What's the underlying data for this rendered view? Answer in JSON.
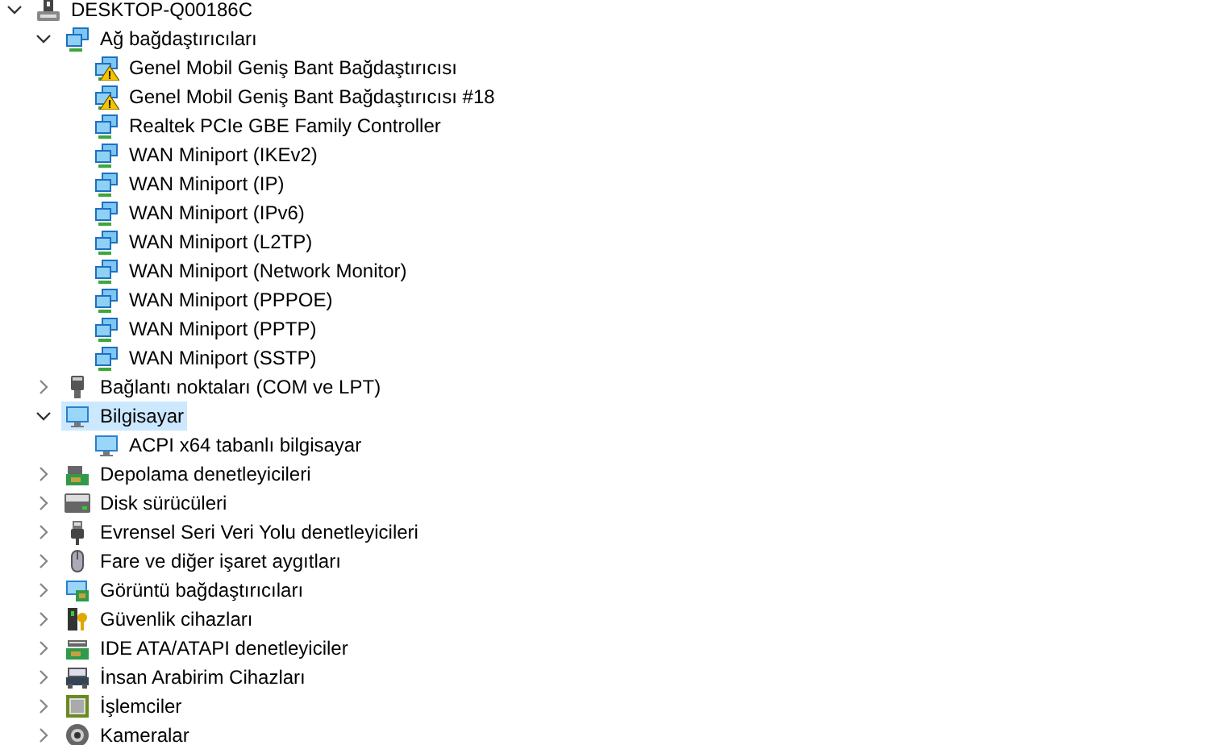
{
  "tree": [
    {
      "label": "DESKTOP-Q00186C",
      "kind": "computer",
      "expanded": true,
      "selected": false,
      "children": [
        {
          "label": "Ağ bağdaştırıcıları",
          "kind": "network",
          "expanded": true,
          "selected": false,
          "children": [
            {
              "label": "Genel Mobil Geniş Bant Bağdaştırıcısı",
              "kind": "network",
              "warning": true,
              "selected": false
            },
            {
              "label": "Genel Mobil Geniş Bant Bağdaştırıcısı #18",
              "kind": "network",
              "warning": true,
              "selected": false
            },
            {
              "label": "Realtek PCIe GBE Family Controller",
              "kind": "network",
              "warning": false,
              "selected": false
            },
            {
              "label": "WAN Miniport (IKEv2)",
              "kind": "network",
              "warning": false,
              "selected": false
            },
            {
              "label": "WAN Miniport (IP)",
              "kind": "network",
              "warning": false,
              "selected": false
            },
            {
              "label": "WAN Miniport (IPv6)",
              "kind": "network",
              "warning": false,
              "selected": false
            },
            {
              "label": "WAN Miniport (L2TP)",
              "kind": "network",
              "warning": false,
              "selected": false
            },
            {
              "label": "WAN Miniport (Network Monitor)",
              "kind": "network",
              "warning": false,
              "selected": false
            },
            {
              "label": "WAN Miniport (PPPOE)",
              "kind": "network",
              "warning": false,
              "selected": false
            },
            {
              "label": "WAN Miniport (PPTP)",
              "kind": "network",
              "warning": false,
              "selected": false
            },
            {
              "label": "WAN Miniport (SSTP)",
              "kind": "network",
              "warning": false,
              "selected": false
            }
          ]
        },
        {
          "label": "Bağlantı noktaları (COM ve LPT)",
          "kind": "port",
          "expanded": false,
          "selected": false
        },
        {
          "label": "Bilgisayar",
          "kind": "monitor",
          "expanded": true,
          "selected": true,
          "children": [
            {
              "label": "ACPI x64 tabanlı bilgisayar",
              "kind": "monitor",
              "warning": false,
              "selected": false
            }
          ]
        },
        {
          "label": "Depolama denetleyicileri",
          "kind": "storage",
          "expanded": false,
          "selected": false
        },
        {
          "label": "Disk sürücüleri",
          "kind": "disk",
          "expanded": false,
          "selected": false
        },
        {
          "label": "Evrensel Seri Veri Yolu denetleyicileri",
          "kind": "usb",
          "expanded": false,
          "selected": false
        },
        {
          "label": "Fare ve diğer işaret aygıtları",
          "kind": "mouse",
          "expanded": false,
          "selected": false
        },
        {
          "label": "Görüntü bağdaştırıcıları",
          "kind": "display",
          "expanded": false,
          "selected": false
        },
        {
          "label": "Güvenlik cihazları",
          "kind": "security",
          "expanded": false,
          "selected": false
        },
        {
          "label": "IDE ATA/ATAPI denetleyiciler",
          "kind": "ide",
          "expanded": false,
          "selected": false
        },
        {
          "label": "İnsan Arabirim Cihazları",
          "kind": "hid",
          "expanded": false,
          "selected": false
        },
        {
          "label": "İşlemciler",
          "kind": "cpu",
          "expanded": false,
          "selected": false
        },
        {
          "label": "Kameralar",
          "kind": "camera",
          "expanded": false,
          "selected": false
        }
      ]
    }
  ]
}
